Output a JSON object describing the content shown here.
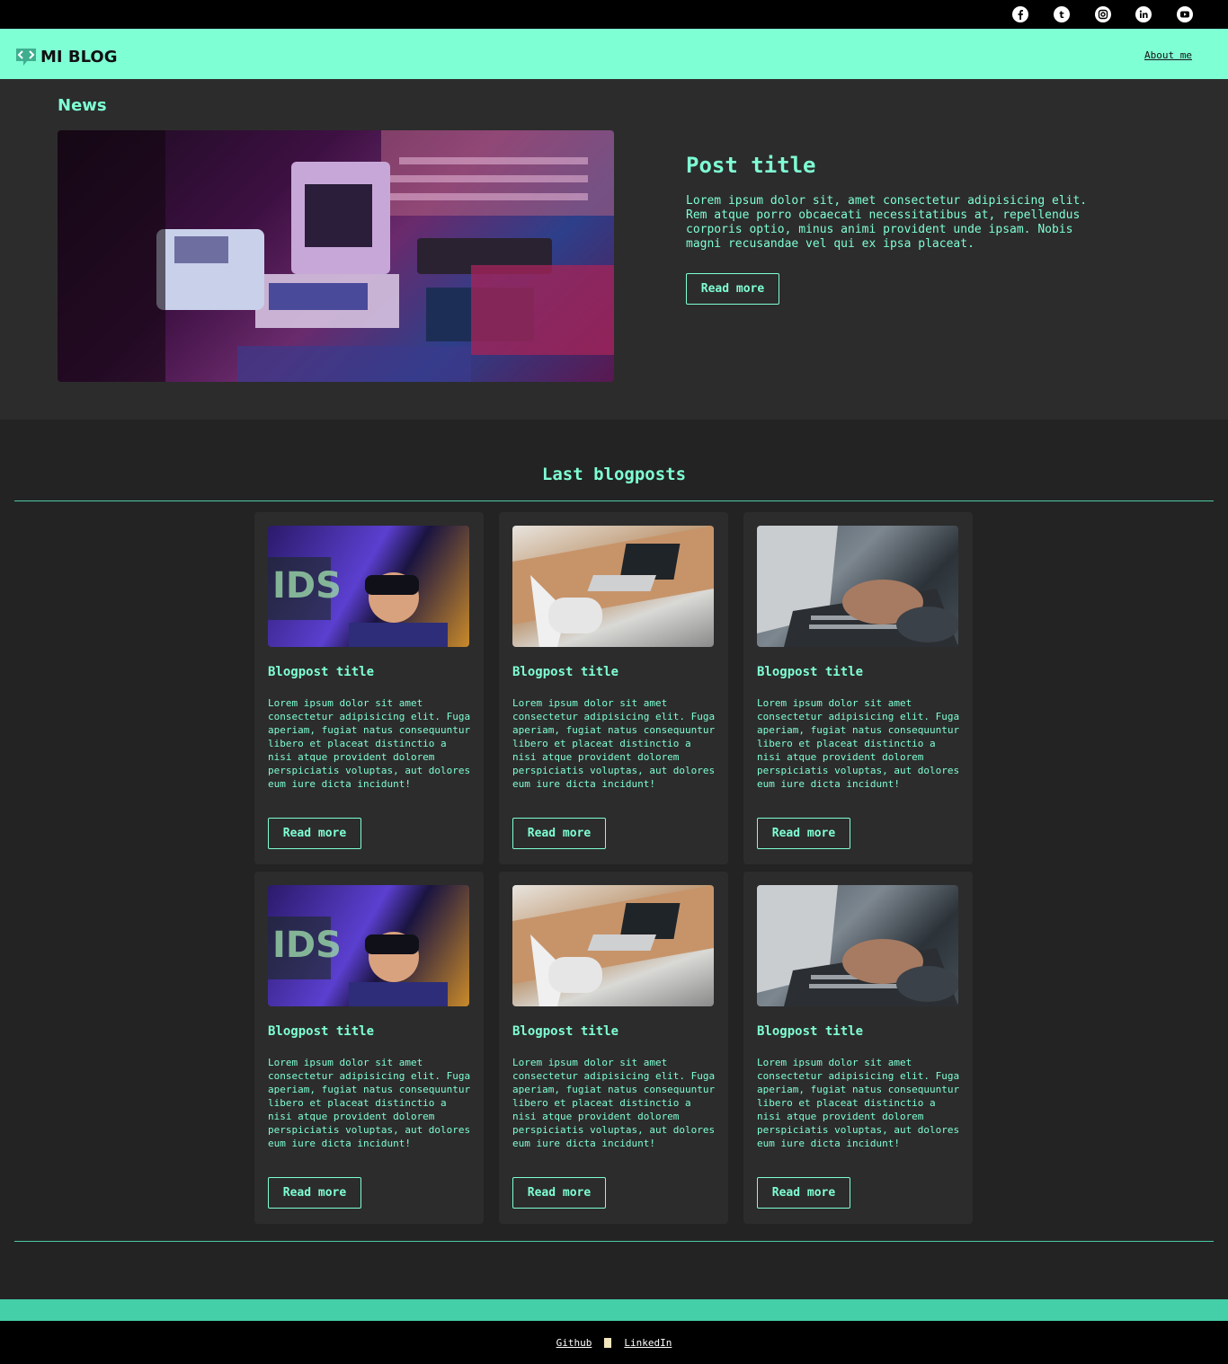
{
  "social": {
    "icons": [
      "facebook-icon",
      "tumblr-icon",
      "instagram-icon",
      "linkedin-icon",
      "youtube-icon"
    ],
    "tumblr_glyph": "t"
  },
  "header": {
    "logo_text": "MI BLOG",
    "about_link": "About me"
  },
  "news": {
    "heading": "News",
    "post_title": "Post title",
    "post_text": "Lorem ipsum dolor sit, amet consectetur adipisicing elit. Rem atque porro obcaecati necessitatibus at, repellendus corporis optio, minus animi provident unde ipsam. Nobis magni recusandae vel qui ex ipsa placeat.",
    "button": "Read more"
  },
  "blog": {
    "heading": "Last blogposts",
    "cards": [
      {
        "title": "Blogpost title",
        "text": "Lorem ipsum dolor sit amet consectetur adipisicing elit. Fuga aperiam, fugiat natus consequuntur libero et placeat distinctio a nisi atque provident dolorem perspiciatis voluptas, aut dolores eum iure dicta incidunt!",
        "button": "Read more"
      },
      {
        "title": "Blogpost title",
        "text": "Lorem ipsum dolor sit amet consectetur adipisicing elit. Fuga aperiam, fugiat natus consequuntur libero et placeat distinctio a nisi atque provident dolorem perspiciatis voluptas, aut dolores eum iure dicta incidunt!",
        "button": "Read more"
      },
      {
        "title": "Blogpost title",
        "text": "Lorem ipsum dolor sit amet consectetur adipisicing elit. Fuga aperiam, fugiat natus consequuntur libero et placeat distinctio a nisi atque provident dolorem perspiciatis voluptas, aut dolores eum iure dicta incidunt!",
        "button": "Read more"
      },
      {
        "title": "Blogpost title",
        "text": "Lorem ipsum dolor sit amet consectetur adipisicing elit. Fuga aperiam, fugiat natus consequuntur libero et placeat distinctio a nisi atque provident dolorem perspiciatis voluptas, aut dolores eum iure dicta incidunt!",
        "button": "Read more"
      },
      {
        "title": "Blogpost title",
        "text": "Lorem ipsum dolor sit amet consectetur adipisicing elit. Fuga aperiam, fugiat natus consequuntur libero et placeat distinctio a nisi atque provident dolorem perspiciatis voluptas, aut dolores eum iure dicta incidunt!",
        "button": "Read more"
      },
      {
        "title": "Blogpost title",
        "text": "Lorem ipsum dolor sit amet consectetur adipisicing elit. Fuga aperiam, fugiat natus consequuntur libero et placeat distinctio a nisi atque provident dolorem perspiciatis voluptas, aut dolores eum iure dicta incidunt!",
        "button": "Read more"
      }
    ]
  },
  "footer": {
    "github": "Github",
    "linkedin": "LinkedIn"
  },
  "colors": {
    "accent": "#7fffd4",
    "header_bg": "#7fffd4",
    "news_bg": "#2c2c2c",
    "page_bg": "#222322",
    "footer_band": "#44cfa8"
  }
}
